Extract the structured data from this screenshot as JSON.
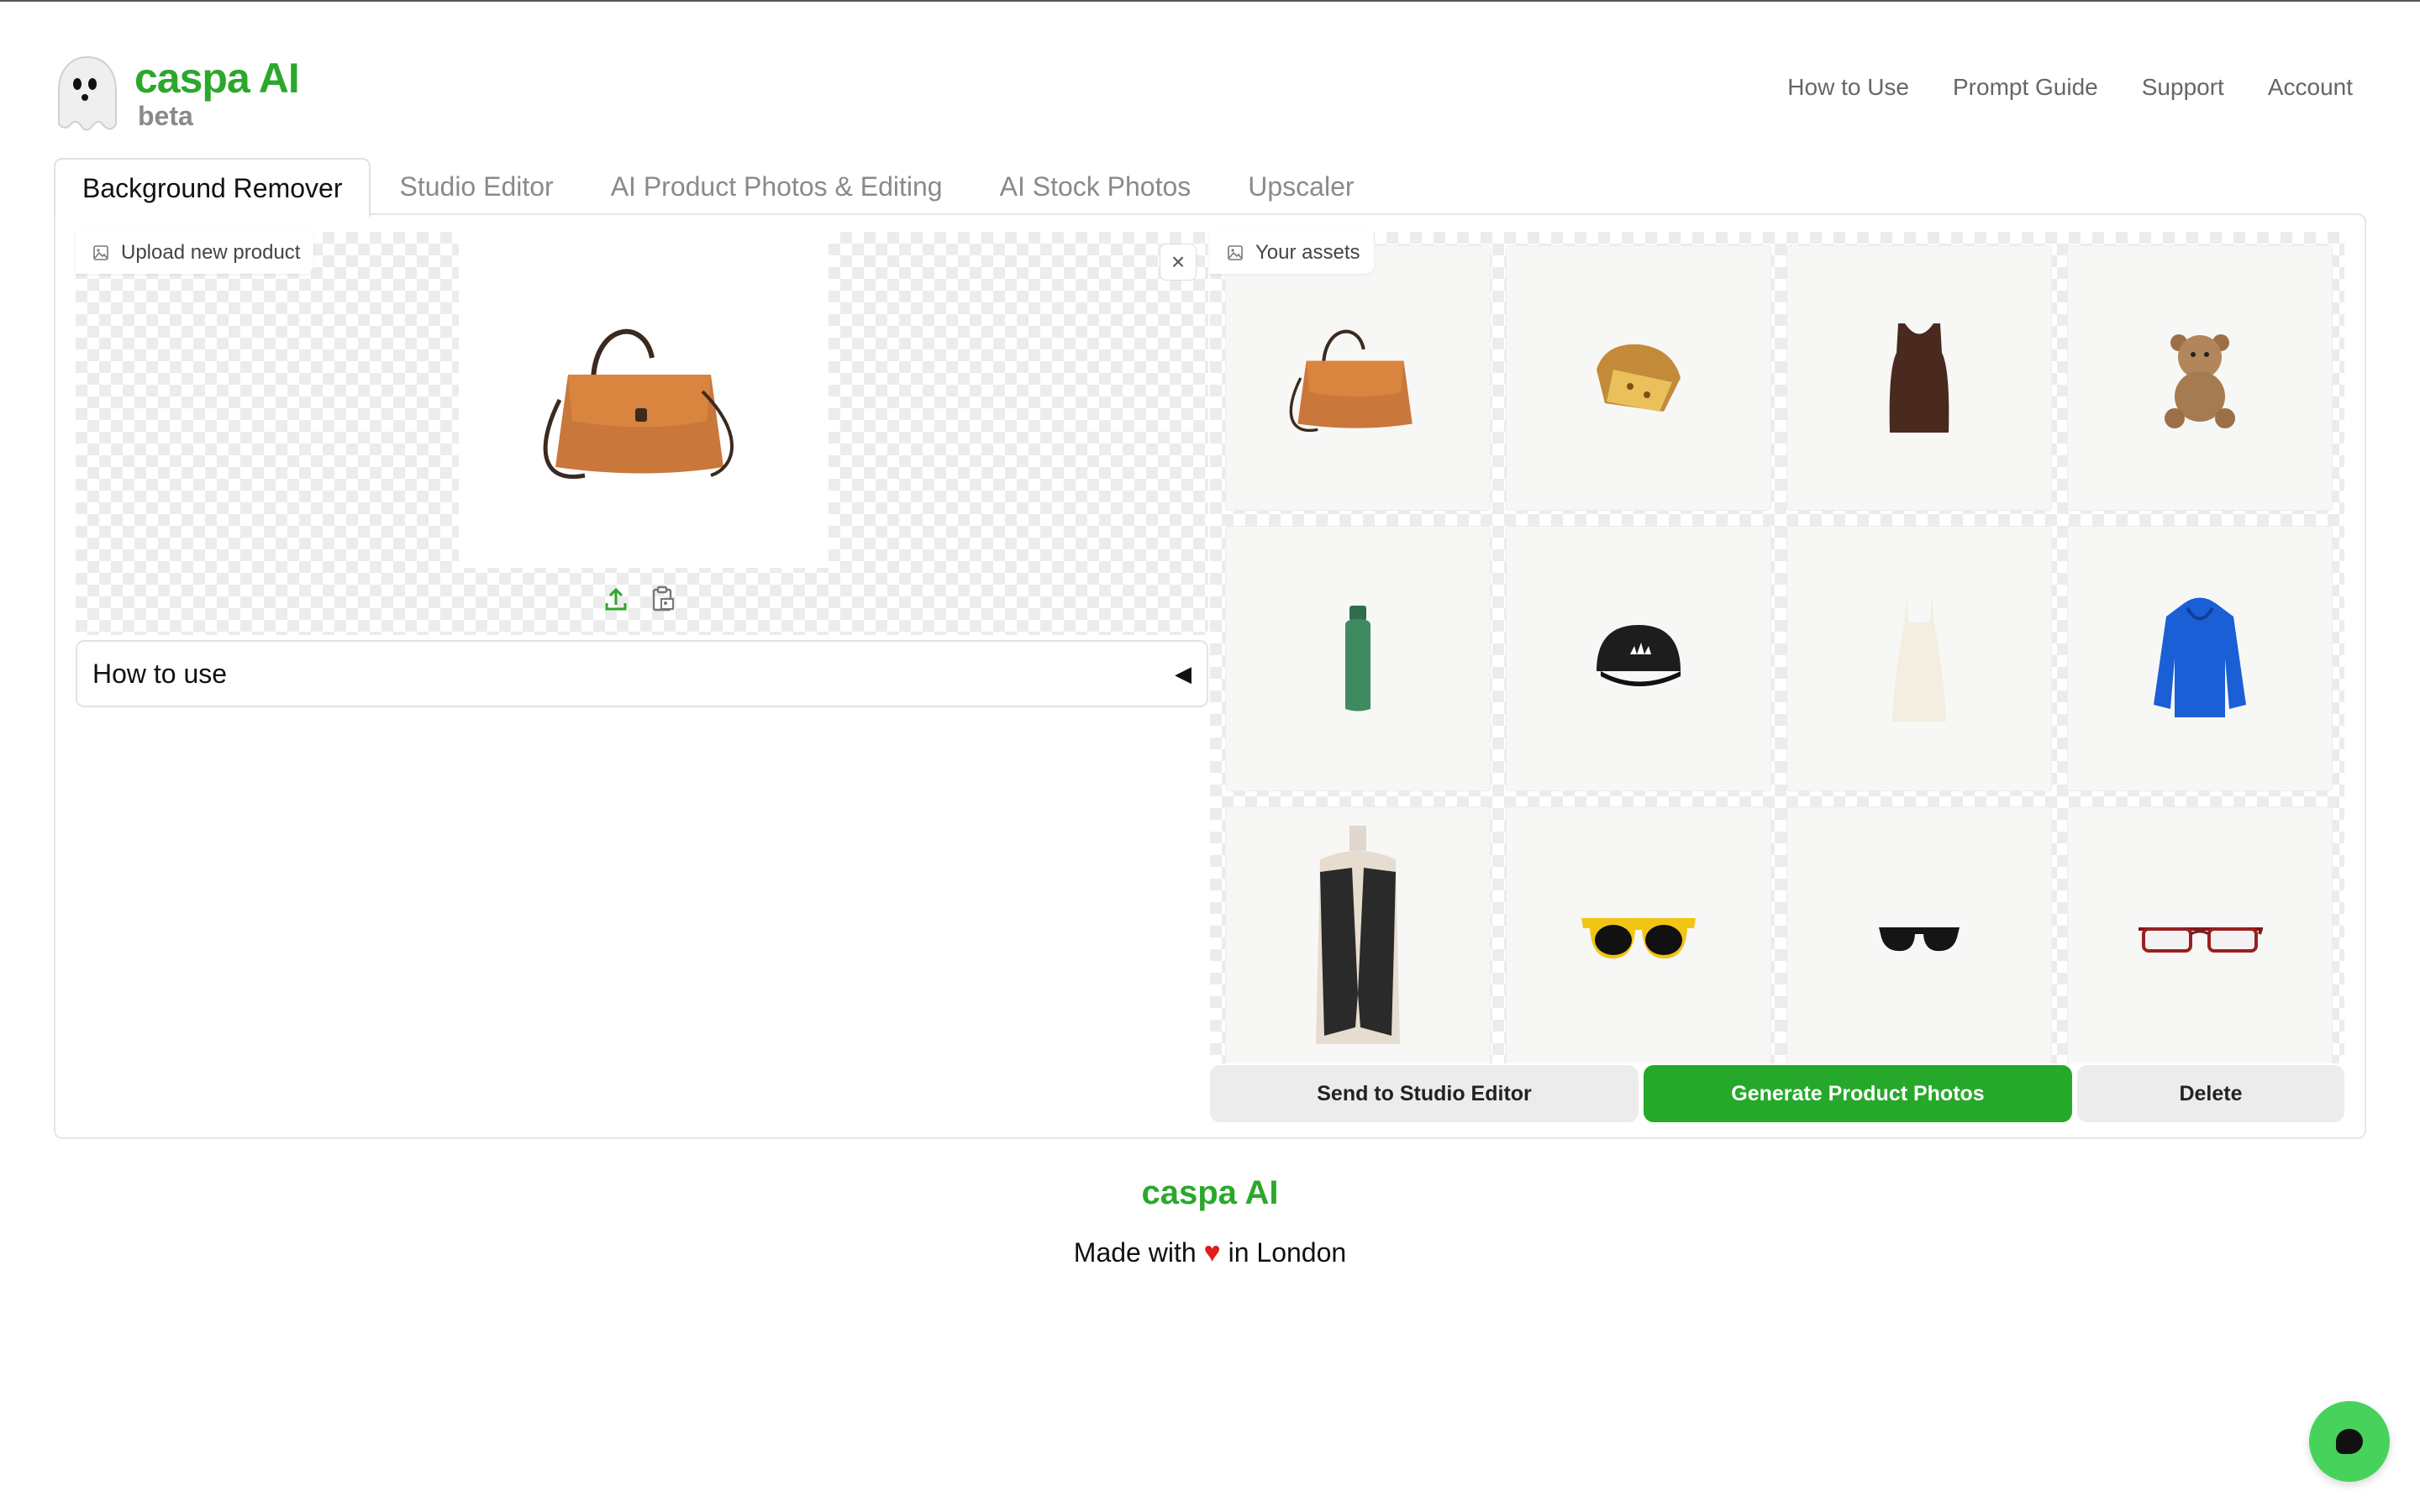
{
  "brand": {
    "name": "caspa AI",
    "tag": "beta"
  },
  "nav": [
    "How to Use",
    "Prompt Guide",
    "Support",
    "Account"
  ],
  "tabs": [
    "Background Remover",
    "Studio Editor",
    "AI Product Photos & Editing",
    "AI Stock Photos",
    "Upscaler"
  ],
  "active_tab": "Background Remover",
  "left": {
    "upload_label": "Upload new product",
    "close_icon": "close-icon",
    "howto_label": "How to use",
    "howto_caret": "◀"
  },
  "assets": {
    "label": "Your assets",
    "items": [
      "handbag",
      "panettone",
      "brown-tank-top",
      "teddy-bear",
      "green-bottle",
      "black-cap",
      "cream-slip-dress",
      "blue-hoodie",
      "black-vest",
      "yellow-sunglasses",
      "black-sunglasses",
      "red-glasses"
    ]
  },
  "actions": {
    "send": "Send to Studio Editor",
    "generate": "Generate Product Photos",
    "delete": "Delete"
  },
  "footer": {
    "brand": "caspa AI",
    "made_prefix": "Made with",
    "heart": "♥",
    "made_suffix": "in London"
  },
  "colors": {
    "brand_green": "#2ba82b",
    "button_green": "#26a82a",
    "chat_green": "#47d35b",
    "heart_red": "#e21b1b"
  }
}
